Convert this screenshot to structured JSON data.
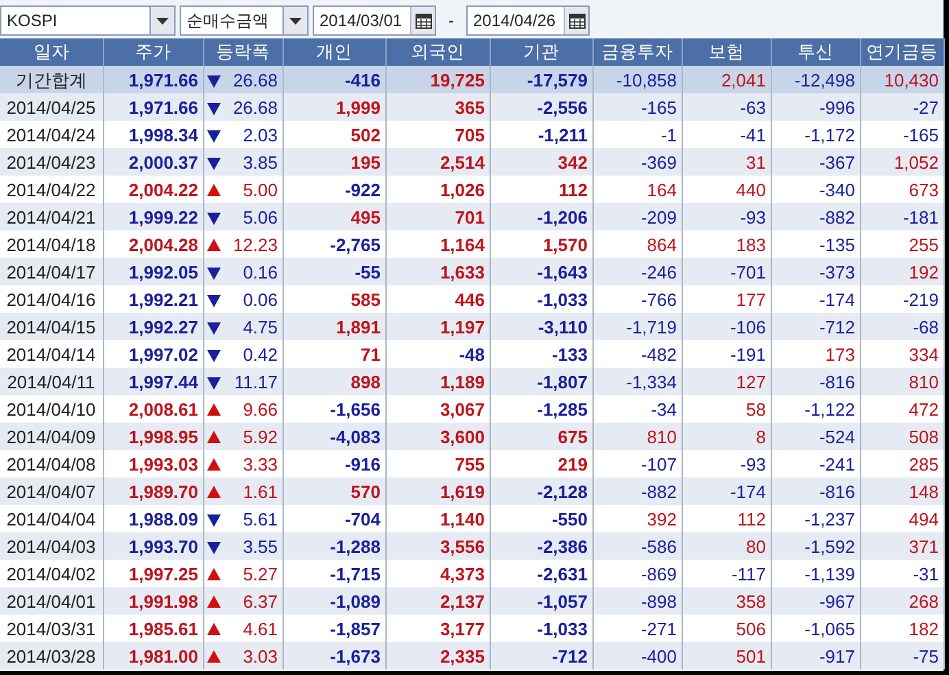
{
  "toolbar": {
    "market": "KOSPI",
    "measure": "순매수금액",
    "start_date": "2014/03/01",
    "separator": "-",
    "end_date": "2014/04/26"
  },
  "columns": [
    "일자",
    "주가",
    "등락폭",
    "개인",
    "외국인",
    "기관",
    "금융투자",
    "보험",
    "투신",
    "연기금등"
  ],
  "rows": [
    {
      "kind": "total",
      "date": "기간합계",
      "price": "1,971.66",
      "rising": false,
      "change": "26.68",
      "values": [
        "-416",
        "19,725",
        "-17,579",
        "-10,858",
        "2,041",
        "-12,498",
        "10,430"
      ]
    },
    {
      "kind": "day",
      "date": "2014/04/25",
      "price": "1,971.66",
      "rising": false,
      "change": "26.68",
      "values": [
        "1,999",
        "365",
        "-2,556",
        "-165",
        "-63",
        "-996",
        "-27"
      ]
    },
    {
      "kind": "day",
      "date": "2014/04/24",
      "price": "1,998.34",
      "rising": false,
      "change": "2.03",
      "values": [
        "502",
        "705",
        "-1,211",
        "-1",
        "-41",
        "-1,172",
        "-165"
      ]
    },
    {
      "kind": "day",
      "date": "2014/04/23",
      "price": "2,000.37",
      "rising": false,
      "change": "3.85",
      "values": [
        "195",
        "2,514",
        "342",
        "-369",
        "31",
        "-367",
        "1,052"
      ]
    },
    {
      "kind": "day",
      "date": "2014/04/22",
      "price": "2,004.22",
      "rising": true,
      "change": "5.00",
      "values": [
        "-922",
        "1,026",
        "112",
        "164",
        "440",
        "-340",
        "673"
      ]
    },
    {
      "kind": "day",
      "date": "2014/04/21",
      "price": "1,999.22",
      "rising": false,
      "change": "5.06",
      "values": [
        "495",
        "701",
        "-1,206",
        "-209",
        "-93",
        "-882",
        "-181"
      ]
    },
    {
      "kind": "day",
      "date": "2014/04/18",
      "price": "2,004.28",
      "rising": true,
      "change": "12.23",
      "values": [
        "-2,765",
        "1,164",
        "1,570",
        "864",
        "183",
        "-135",
        "255"
      ]
    },
    {
      "kind": "day",
      "date": "2014/04/17",
      "price": "1,992.05",
      "rising": false,
      "change": "0.16",
      "values": [
        "-55",
        "1,633",
        "-1,643",
        "-246",
        "-701",
        "-373",
        "192"
      ]
    },
    {
      "kind": "day",
      "date": "2014/04/16",
      "price": "1,992.21",
      "rising": false,
      "change": "0.06",
      "values": [
        "585",
        "446",
        "-1,033",
        "-766",
        "177",
        "-174",
        "-219"
      ]
    },
    {
      "kind": "day",
      "date": "2014/04/15",
      "price": "1,992.27",
      "rising": false,
      "change": "4.75",
      "values": [
        "1,891",
        "1,197",
        "-3,110",
        "-1,719",
        "-106",
        "-712",
        "-68"
      ]
    },
    {
      "kind": "day",
      "date": "2014/04/14",
      "price": "1,997.02",
      "rising": false,
      "change": "0.42",
      "values": [
        "71",
        "-48",
        "-133",
        "-482",
        "-191",
        "173",
        "334"
      ]
    },
    {
      "kind": "day",
      "date": "2014/04/11",
      "price": "1,997.44",
      "rising": false,
      "change": "11.17",
      "values": [
        "898",
        "1,189",
        "-1,807",
        "-1,334",
        "127",
        "-816",
        "810"
      ]
    },
    {
      "kind": "day",
      "date": "2014/04/10",
      "price": "2,008.61",
      "rising": true,
      "change": "9.66",
      "values": [
        "-1,656",
        "3,067",
        "-1,285",
        "-34",
        "58",
        "-1,122",
        "472"
      ]
    },
    {
      "kind": "day",
      "date": "2014/04/09",
      "price": "1,998.95",
      "rising": true,
      "change": "5.92",
      "values": [
        "-4,083",
        "3,600",
        "675",
        "810",
        "8",
        "-524",
        "508"
      ]
    },
    {
      "kind": "day",
      "date": "2014/04/08",
      "price": "1,993.03",
      "rising": true,
      "change": "3.33",
      "values": [
        "-916",
        "755",
        "219",
        "-107",
        "-93",
        "-241",
        "285"
      ]
    },
    {
      "kind": "day",
      "date": "2014/04/07",
      "price": "1,989.70",
      "rising": true,
      "change": "1.61",
      "values": [
        "570",
        "1,619",
        "-2,128",
        "-882",
        "-174",
        "-816",
        "148"
      ]
    },
    {
      "kind": "day",
      "date": "2014/04/04",
      "price": "1,988.09",
      "rising": false,
      "change": "5.61",
      "values": [
        "-704",
        "1,140",
        "-550",
        "392",
        "112",
        "-1,237",
        "494"
      ]
    },
    {
      "kind": "day",
      "date": "2014/04/03",
      "price": "1,993.70",
      "rising": false,
      "change": "3.55",
      "values": [
        "-1,288",
        "3,556",
        "-2,386",
        "-586",
        "80",
        "-1,592",
        "371"
      ]
    },
    {
      "kind": "day",
      "date": "2014/04/02",
      "price": "1,997.25",
      "rising": true,
      "change": "5.27",
      "values": [
        "-1,715",
        "4,373",
        "-2,631",
        "-869",
        "-117",
        "-1,139",
        "-31"
      ]
    },
    {
      "kind": "day",
      "date": "2014/04/01",
      "price": "1,991.98",
      "rising": true,
      "change": "6.37",
      "values": [
        "-1,089",
        "2,137",
        "-1,057",
        "-898",
        "358",
        "-967",
        "268"
      ]
    },
    {
      "kind": "day",
      "date": "2014/03/31",
      "price": "1,985.61",
      "rising": true,
      "change": "4.61",
      "values": [
        "-1,857",
        "3,177",
        "-1,033",
        "-271",
        "506",
        "-1,065",
        "182"
      ]
    },
    {
      "kind": "day",
      "date": "2014/03/28",
      "price": "1,981.00",
      "rising": true,
      "change": "3.03",
      "values": [
        "-1,673",
        "2,335",
        "-712",
        "-400",
        "501",
        "-917",
        "-75"
      ]
    }
  ]
}
